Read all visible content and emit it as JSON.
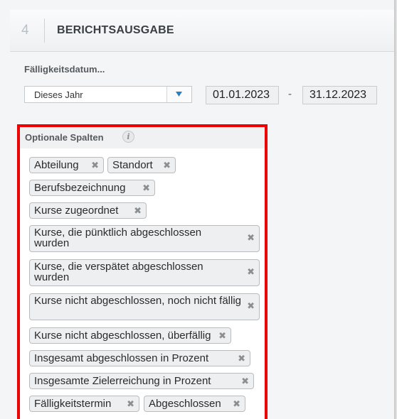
{
  "section": {
    "number": "4",
    "title": "BERICHTSAUSGABE"
  },
  "due_date": {
    "label": "Fälligkeitsdatum...",
    "range_select_value": "Dieses Jahr",
    "dropdown_icon": "triangle-down-icon",
    "start_date": "01.01.2023",
    "separator": "-",
    "end_date": "31.12.2023"
  },
  "optional_columns": {
    "label": "Optionale Spalten",
    "info_icon": "info-icon",
    "info_glyph": "i",
    "remove_glyph": "✖",
    "tags": [
      "Abteilung",
      "Standort",
      "Berufsbezeichnung",
      "Kurse zugeordnet",
      "Kurse, die pünktlich abgeschlossen wurden",
      "Kurse, die verspätet abgeschlossen wurden",
      "Kurse nicht abgeschlossen, noch nicht fällig",
      "Kurse nicht abgeschlossen, überfällig",
      "Insgesamt abgeschlossen in Prozent",
      "Insgesamte Zielerreichung in Prozent",
      "Fälligkeitstermin",
      "Abgeschlossen"
    ]
  },
  "colors": {
    "highlight_border": "#ee0000",
    "tag_background": "#eeeff1",
    "accent_arrow": "#2a7fc0"
  }
}
